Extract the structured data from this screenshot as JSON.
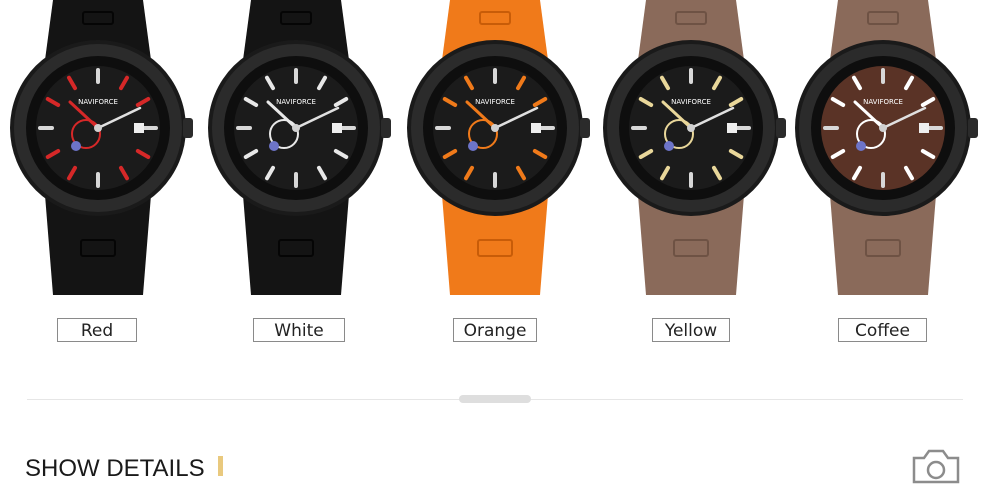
{
  "variants": [
    {
      "label": "Red",
      "strap": "#141414",
      "strap_shade": "#050505",
      "accent": "#d62828",
      "dial": "#1b1b1b"
    },
    {
      "label": "White",
      "strap": "#141414",
      "strap_shade": "#050505",
      "accent": "#e8e8e8",
      "dial": "#1b1b1b"
    },
    {
      "label": "Orange",
      "strap": "#f07a1a",
      "strap_shade": "#c85c08",
      "accent": "#f07a1a",
      "dial": "#1b1b1b"
    },
    {
      "label": "Yellow",
      "strap": "#8a6a5a",
      "strap_shade": "#6e5244",
      "accent": "#e9d79a",
      "dial": "#1b1b1b"
    },
    {
      "label": "Coffee",
      "strap": "#8a6a5a",
      "strap_shade": "#6e5244",
      "accent": "#ffffff",
      "dial": "#5a3326"
    }
  ],
  "brand_text": "NAVIFORCE",
  "section": {
    "title": "SHOW DETAILS"
  },
  "colors": {
    "divider": "#e6e6e6",
    "accent_bar": "#e9c97e"
  },
  "icons": {
    "camera": "camera-icon"
  }
}
